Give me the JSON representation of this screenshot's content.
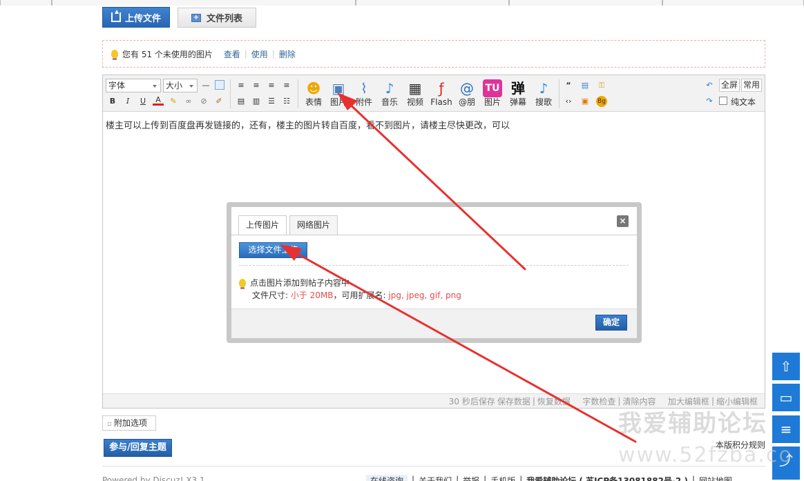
{
  "tabs": {
    "upload": "上传文件",
    "file_list": "文件列表"
  },
  "notice": {
    "text": "您有 51 个未使用的图片",
    "view": "查看",
    "use": "使用",
    "delete": "删除"
  },
  "toolbar": {
    "font": "字体",
    "size": "大小",
    "bold": "B",
    "italic": "I",
    "underline": "U",
    "font_color": "A",
    "emoji": "表情",
    "image": "图片",
    "attachment": "附件",
    "music": "音乐",
    "video": "视频",
    "flash": "Flash",
    "at_friend": "@朋",
    "tu_image": "图片",
    "danmaku": "弹幕",
    "search_song": "搜歌",
    "fullscreen": "全屏",
    "common": "常用",
    "plain_text": "纯文本"
  },
  "editor": {
    "content": "楼主可以上传到百度盘再发链接的，还有，楼主的图片转自百度，看不到图片，请楼主尽快更改，可以"
  },
  "statusbar": {
    "autosave": "30 秒后保存",
    "save": "保存数据",
    "restore": "恢复数据",
    "wordcheck": "字数检查",
    "clear": "清除内容",
    "enlarge": "加大编辑框",
    "shrink": "缩小编辑框"
  },
  "dialog": {
    "tab_upload": "上传图片",
    "tab_web": "网络图片",
    "choose_button": "选择文件上传",
    "tip": "点击图片添加到帖子内容中",
    "size_label": "文件尺寸: ",
    "size_value": "小于 20MB",
    "ext_label": "，可用扩展名: ",
    "ext_value": "jpg, jpeg, gif, png",
    "ok": "确定"
  },
  "below": {
    "add_options": "附加选项",
    "reply_button": "参与/回复主题",
    "rules": "本版积分规则"
  },
  "footer": {
    "powered": "Powered by Discuz! X3.1",
    "online": "在线咨询",
    "about": "关于我们",
    "report": "举报",
    "mobile": "手机版",
    "forum": "我爱辅助论坛 ( 苏ICP备13081882号-2 )",
    "sitemap": "网站地图"
  },
  "watermark": {
    "line1": "我爱辅助论坛",
    "line2": "www.52fzba.co"
  },
  "colors": {
    "accent_blue": "#2a67b4",
    "arrow_red": "#e83030",
    "link_blue": "#336699"
  }
}
